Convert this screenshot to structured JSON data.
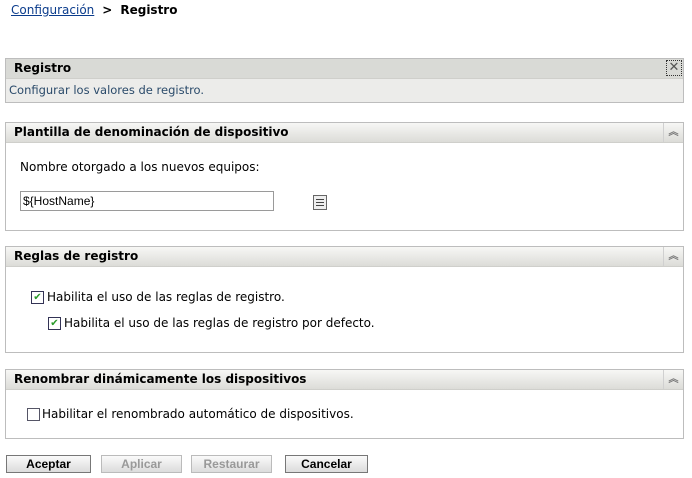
{
  "breadcrumb": {
    "parent": "Configuración",
    "separator": ">",
    "current": "Registro"
  },
  "info_panel": {
    "title": "Registro",
    "description": "Configurar los valores de registro."
  },
  "naming_panel": {
    "title": "Plantilla de denominación de dispositivo",
    "label": "Nombre otorgado a los nuevos equipos:",
    "value": "${HostName}"
  },
  "rules_panel": {
    "title": "Reglas de registro",
    "options": [
      {
        "label": "Habilita el uso de las reglas de registro.",
        "checked": true
      },
      {
        "label": "Habilita el uso de las reglas de registro por defecto.",
        "checked": true
      }
    ]
  },
  "rename_panel": {
    "title": "Renombrar dinámicamente los dispositivos",
    "options": [
      {
        "label": "Habilitar el renombrado automático de dispositivos.",
        "checked": false
      }
    ]
  },
  "buttons": {
    "accept": "Aceptar",
    "apply": "Aplicar",
    "restore": "Restaurar",
    "cancel": "Cancelar"
  }
}
